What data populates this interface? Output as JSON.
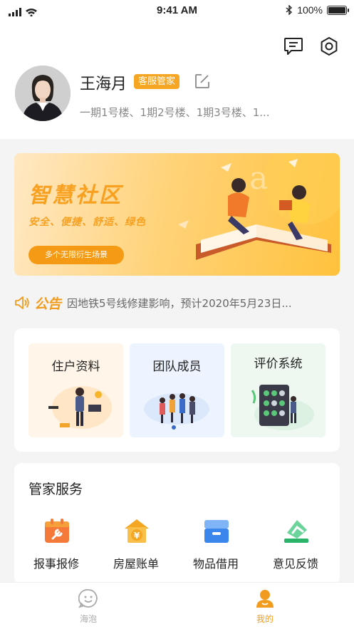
{
  "status_bar": {
    "time": "9:41 AM",
    "battery": "100%"
  },
  "profile": {
    "name": "王海月",
    "role": "客服管家",
    "buildings": "一期1号楼、1期2号楼、1期3号楼、1..."
  },
  "banner": {
    "title": "智慧社区",
    "subtitle": "安全、便捷、舒适、绿色",
    "cta": "多个无限衍生场景"
  },
  "notice": {
    "title": "公告",
    "text": "因地铁5号线修建影响，预计2020年5月23日..."
  },
  "features": [
    {
      "label": "住户资料"
    },
    {
      "label": "团队成员"
    },
    {
      "label": "评价系统"
    }
  ],
  "services": {
    "title": "管家服务",
    "items": [
      {
        "label": "报事报修"
      },
      {
        "label": "房屋账单"
      },
      {
        "label": "物品借用"
      },
      {
        "label": "意见反馈"
      }
    ]
  },
  "tabs": [
    {
      "label": "海泡"
    },
    {
      "label": "我的"
    }
  ],
  "colors": {
    "accent": "#f6a623",
    "tab_active": "#f29c1f",
    "tab_inactive": "#aaaaaa"
  }
}
